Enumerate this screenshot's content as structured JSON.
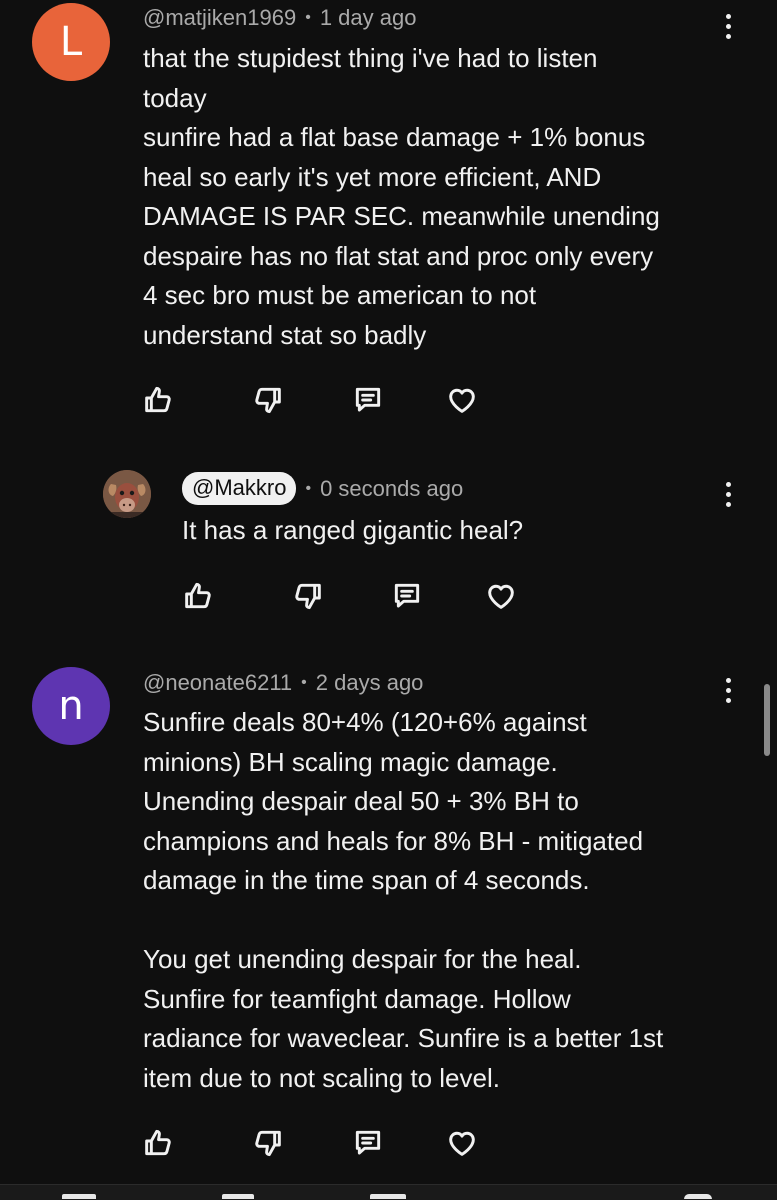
{
  "comments": [
    {
      "avatar_letter": "L",
      "avatar_color": "#e8643a",
      "author": "@matjiken1969",
      "separator": "•",
      "time": "1 day ago",
      "lines": [
        "that the stupidest thing i've had to listen",
        "today",
        "sunfire had a flat base damage + 1% bonus",
        "heal so early it's yet more efficient, AND",
        "DAMAGE IS PAR SEC. meanwhile unending",
        "despaire has no flat stat and proc only every",
        "4 sec bro must be american to not",
        "understand stat so badly"
      ]
    },
    {
      "avatar_icon": "goat-avatar-icon",
      "author": "@Makkro",
      "separator": "•",
      "time": "0 seconds ago",
      "lines": [
        "It has a ranged gigantic heal?"
      ]
    },
    {
      "avatar_letter": "n",
      "avatar_color": "#5e35b1",
      "author": "@neonate6211",
      "separator": "•",
      "time": "2 days ago",
      "lines": [
        "Sunfire deals 80+4% (120+6% against",
        "minions) BH scaling magic damage.",
        "Unending despair deal 50 + 3% BH to",
        "champions and heals for 8% BH - mitigated",
        "damage in the time span of 4 seconds.",
        "",
        "You get unending despair for the heal.",
        "Sunfire for teamfight damage. Hollow",
        "radiance for waveclear. Sunfire is a better 1st",
        "item due to not scaling to level."
      ]
    }
  ],
  "icons": {
    "like": "thumbs-up-icon",
    "dislike": "thumbs-down-icon",
    "reply": "reply-icon",
    "heart": "heart-icon",
    "more": "more-vertical-icon"
  },
  "colors": {
    "background": "#0f0f0f",
    "text_primary": "#f1f1f1",
    "text_secondary": "#aaaaaa"
  }
}
